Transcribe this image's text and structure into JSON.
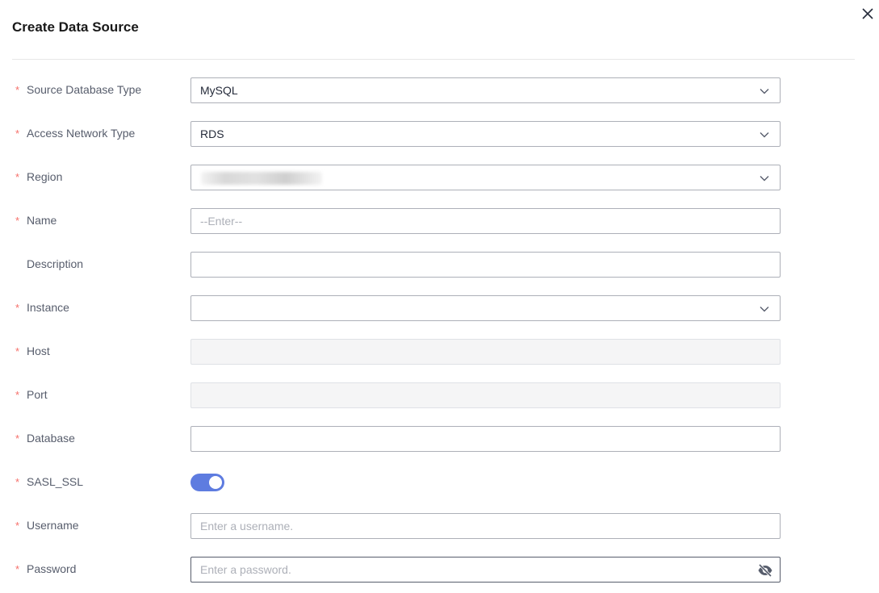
{
  "dialog": {
    "title": "Create Data Source"
  },
  "form": {
    "source_db_type": {
      "label": "Source Database Type",
      "value": "MySQL"
    },
    "access_network_type": {
      "label": "Access Network Type",
      "value": "RDS"
    },
    "region": {
      "label": "Region"
    },
    "name": {
      "label": "Name",
      "placeholder": "--Enter--"
    },
    "description": {
      "label": "Description"
    },
    "instance": {
      "label": "Instance"
    },
    "host": {
      "label": "Host"
    },
    "port": {
      "label": "Port"
    },
    "database": {
      "label": "Database"
    },
    "sasl_ssl": {
      "label": "SASL_SSL",
      "enabled": true
    },
    "username": {
      "label": "Username",
      "placeholder": "Enter a username."
    },
    "password": {
      "label": "Password",
      "placeholder": "Enter a password."
    },
    "required_marker": "*"
  },
  "colors": {
    "accent": "#5e7ce0",
    "required": "#f66f6a"
  }
}
